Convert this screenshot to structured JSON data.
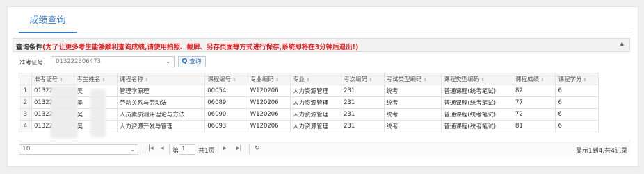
{
  "tab": {
    "label": "成绩查询"
  },
  "condition": {
    "title": "查询条件",
    "warning": "(为了让更多考生能够顺利查询成绩,请使用拍照、截屏、另存页面等方式进行保存,系统即将在3分钟后退出!)"
  },
  "search": {
    "label": "准考证号",
    "value": "013222306473",
    "button_label": "查询"
  },
  "table": {
    "columns": [
      "准考证号",
      "考生姓名",
      "课程名称",
      "课程编号",
      "专业编码",
      "专业",
      "考次编码",
      "考试类型编码",
      "课程类型编码",
      "课程成绩",
      "课程学分"
    ],
    "rows": [
      {
        "n": "1",
        "cells": [
          "01322",
          "吴",
          "管理学原理",
          "00054",
          "W120206",
          "人力资源管理",
          "231",
          "统考",
          "普通课程(统考笔试)",
          "82",
          "6"
        ]
      },
      {
        "n": "2",
        "cells": [
          "01322",
          "吴",
          "劳动关系与劳动法",
          "06089",
          "W120206",
          "人力资源管理",
          "231",
          "统考",
          "普通课程(统考笔试)",
          "77",
          "6"
        ]
      },
      {
        "n": "3",
        "cells": [
          "01322",
          "吴",
          "人员素质测评理论与方法",
          "06090",
          "W120206",
          "人力资源管理",
          "231",
          "统考",
          "普通课程(统考笔试)",
          "72",
          "6"
        ]
      },
      {
        "n": "4",
        "cells": [
          "01322",
          "吴",
          "人力资源开发与管理",
          "06093",
          "W120206",
          "人力资源管理",
          "231",
          "统考",
          "普通课程(统考笔试)",
          "81",
          "6"
        ]
      }
    ]
  },
  "pager": {
    "page_size": "10",
    "page_prefix": "第",
    "page_value": "1",
    "page_total": "共1页",
    "info": "显示1到4,共4记录"
  }
}
